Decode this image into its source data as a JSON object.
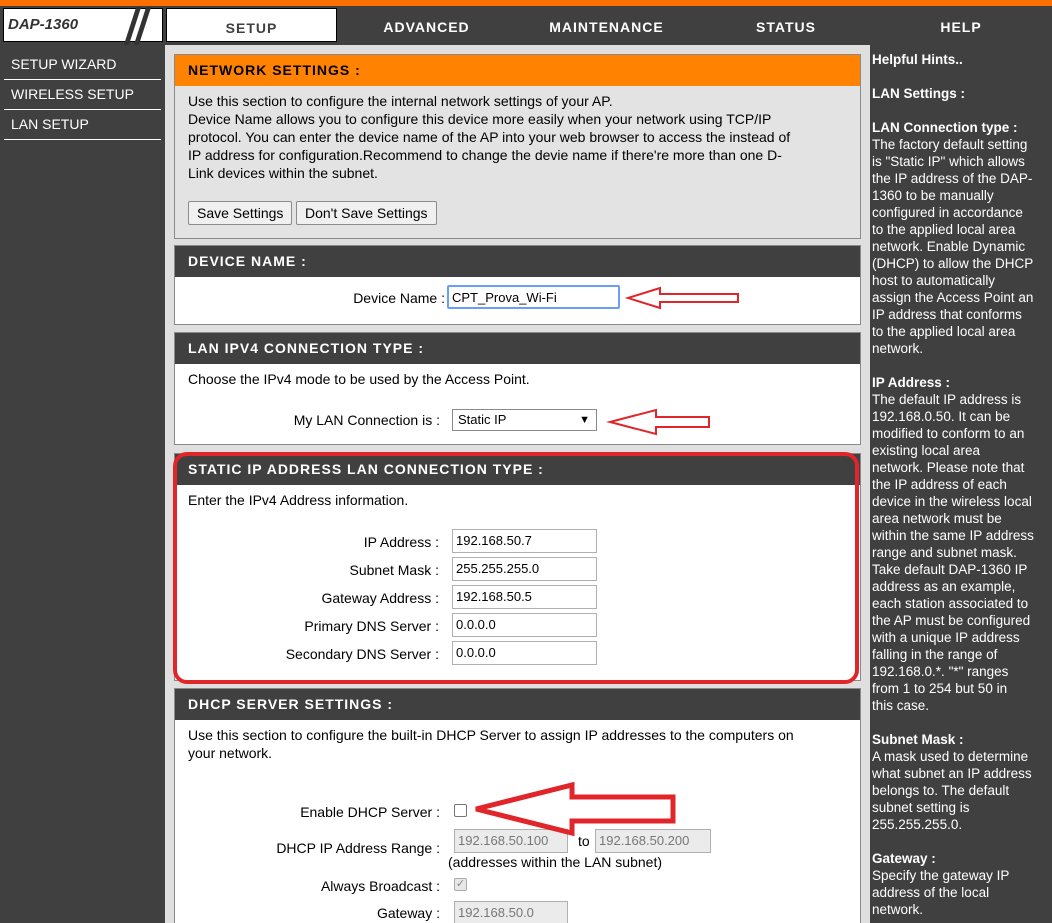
{
  "header": {
    "logo": "DAP-1360",
    "tabs": [
      "SETUP",
      "ADVANCED",
      "MAINTENANCE",
      "STATUS",
      "HELP"
    ]
  },
  "sidebar": {
    "items": [
      "SETUP WIZARD",
      "WIRELESS SETUP",
      "LAN SETUP"
    ]
  },
  "network_settings": {
    "title": "NETWORK SETTINGS :",
    "line1": "Use this section to configure the internal network settings of your AP.",
    "line2": "Device Name allows you to configure this device more easily when your network using TCP/IP",
    "line3": "protocol. You can enter the device name of the AP into your web browser to access the instead of",
    "line4": "IP address for configuration.Recommend to change the devie name if there're more than one D-",
    "line5": "Link devices within the subnet.",
    "save_label": "Save Settings",
    "dont_save_label": "Don't Save Settings"
  },
  "device_name": {
    "title": "DEVICE NAME :",
    "label": "Device Name :",
    "value": "CPT_Prova_Wi-Fi"
  },
  "lan_type": {
    "title": "LAN IPV4 CONNECTION TYPE :",
    "desc": "Choose the IPv4 mode to be used by the Access Point.",
    "label": "My LAN Connection is :",
    "selected": "Static IP"
  },
  "static_ip": {
    "title": "STATIC IP ADDRESS LAN CONNECTION TYPE :",
    "desc": "Enter the IPv4 Address information.",
    "ip_label": "IP Address :",
    "ip_value": "192.168.50.7",
    "mask_label": "Subnet Mask :",
    "mask_value": "255.255.255.0",
    "gw_label": "Gateway Address :",
    "gw_value": "192.168.50.5",
    "dns1_label": "Primary DNS Server :",
    "dns1_value": "0.0.0.0",
    "dns2_label": "Secondary DNS Server :",
    "dns2_value": "0.0.0.0"
  },
  "dhcp": {
    "title": "DHCP SERVER SETTINGS :",
    "desc1": "Use this section to configure the built-in DHCP Server to assign IP addresses to the computers on",
    "desc2": "your network.",
    "enable_label": "Enable DHCP Server :",
    "enabled": false,
    "range_label": "DHCP IP Address Range :",
    "range_start": "192.168.50.100",
    "range_to": "to",
    "range_end": "192.168.50.200",
    "range_note": "(addresses within the LAN subnet)",
    "broadcast_label": "Always Broadcast :",
    "broadcast_checked": true,
    "gateway_label": "Gateway :",
    "gateway_value": "192.168.50.0"
  },
  "hints": {
    "title": "Helpful Hints..",
    "lan_settings": "LAN Settings :",
    "conn_head": "LAN Connection type :",
    "conn_l1": "The factory default setting",
    "conn_l2": "is \"Static IP\" which allows",
    "conn_l3": "the IP address of the DAP-",
    "conn_l4": "1360 to be manually",
    "conn_l5": "configured in accordance",
    "conn_l6": "to the applied local area",
    "conn_l7": "network. Enable Dynamic",
    "conn_l8": "(DHCP) to allow the DHCP",
    "conn_l9": "host to automatically",
    "conn_l10": "assign the Access Point an",
    "conn_l11": "IP address that conforms",
    "conn_l12": "to the applied local area",
    "conn_l13": "network.",
    "ip_head": "IP Address :",
    "ip_l1": "The default IP address is",
    "ip_l2": "192.168.0.50. It can be",
    "ip_l3": "modified to conform to an",
    "ip_l4": "existing local area",
    "ip_l5": "network. Please note that",
    "ip_l6": "the IP address of each",
    "ip_l7": "device in the wireless local",
    "ip_l8": "area network must be",
    "ip_l9": "within the same IP address",
    "ip_l10": "range and subnet mask.",
    "ip_l11": "Take default DAP-1360 IP",
    "ip_l12": "address as an example,",
    "ip_l13": "each station associated to",
    "ip_l14": "the AP must be configured",
    "ip_l15": "with a unique IP address",
    "ip_l16": "falling in the range of",
    "ip_l17": "192.168.0.*. \"*\" ranges",
    "ip_l18": "from 1 to 254 but 50 in",
    "ip_l19": "this case.",
    "mask_head": "Subnet Mask :",
    "mask_l1": "A mask used to determine",
    "mask_l2": "what subnet an IP address",
    "mask_l3": "belongs to. The default",
    "mask_l4": "subnet setting is",
    "mask_l5": "255.255.255.0.",
    "gw_head": "Gateway :",
    "gw_l1": "Specify the gateway IP",
    "gw_l2": "address of the local",
    "gw_l3": "network."
  },
  "colors": {
    "accent": "#ff8200",
    "dark": "#404040",
    "annotation": "#e0262b"
  }
}
